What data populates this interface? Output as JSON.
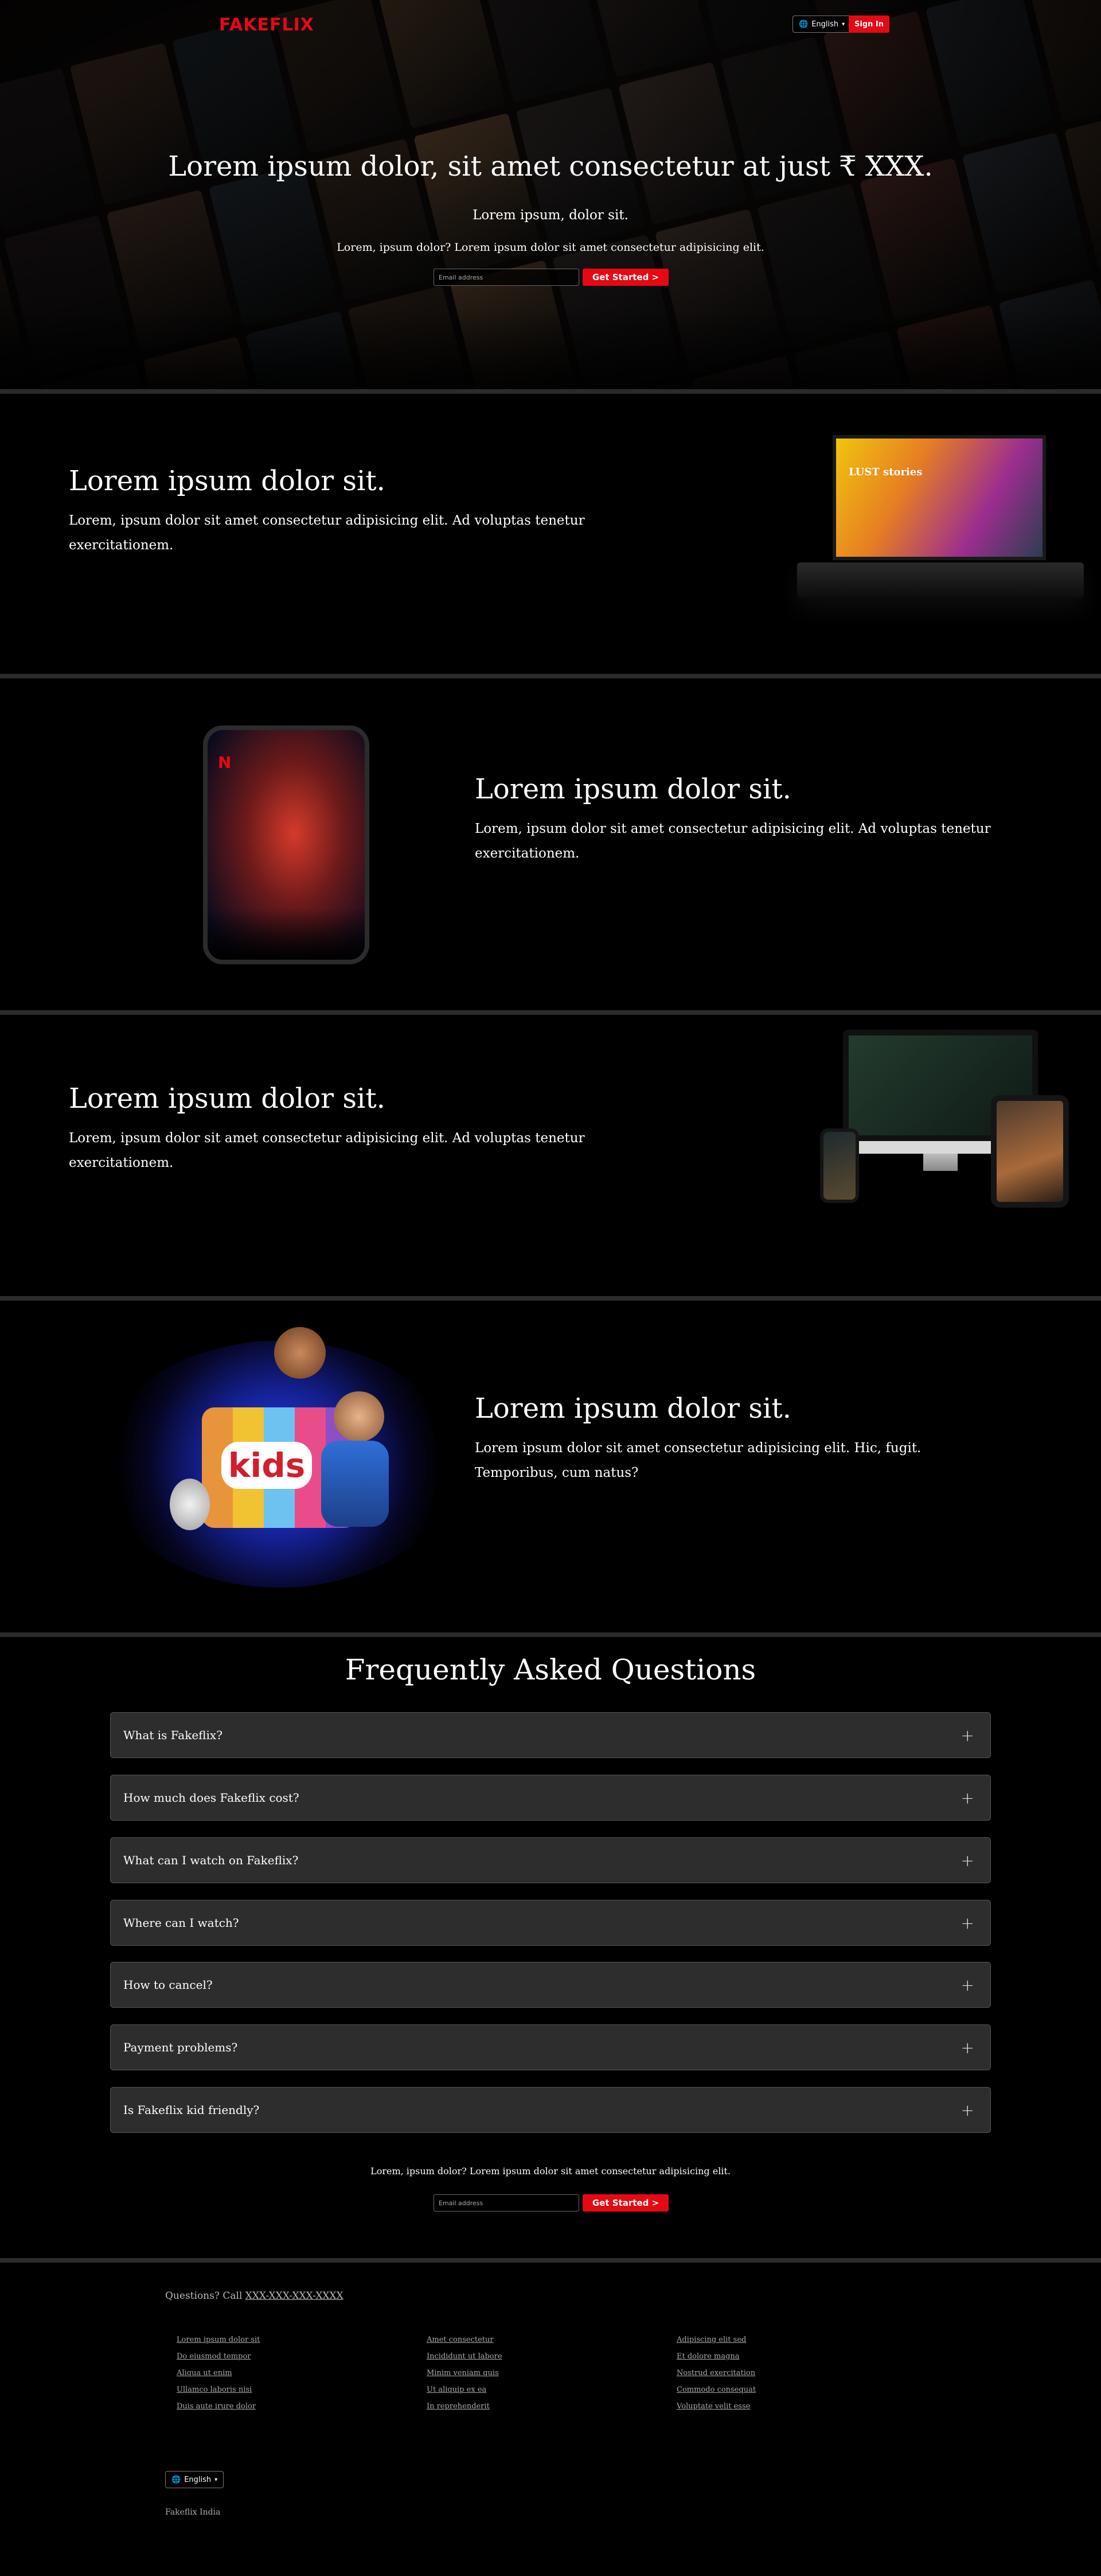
{
  "header": {
    "logo": "FAKEFLIX",
    "language": "English",
    "signin_label": "Sign In"
  },
  "hero": {
    "title": "Lorem ipsum dolor, sit amet consectetur at just ₹ XXX.",
    "subtitle": "Lorem ipsum, dolor sit.",
    "cta_text": "Lorem, ipsum dolor? Lorem ipsum dolor sit amet consectetur adipisicing elit.",
    "email_placeholder": "Email address",
    "get_started_label": "Get Started >"
  },
  "features": [
    {
      "title": "Lorem ipsum dolor sit.",
      "description": "Lorem, ipsum dolor sit amet consectetur adipisicing elit. Ad voluptas tenetur exercitationem.",
      "image_text": "LUST stories"
    },
    {
      "title": "Lorem ipsum dolor sit.",
      "description": "Lorem, ipsum dolor sit amet consectetur adipisicing elit. Ad voluptas tenetur exercitationem.",
      "image_text": "N"
    },
    {
      "title": "Lorem ipsum dolor sit.",
      "description": "Lorem, ipsum dolor sit amet consectetur adipisicing elit. Ad voluptas tenetur exercitationem."
    },
    {
      "title": "Lorem ipsum dolor sit.",
      "description": "Lorem ipsum dolor sit amet consectetur adipisicing elit. Hic, fugit. Temporibus, cum natus?",
      "image_text": "kids"
    }
  ],
  "faq": {
    "title": "Frequently Asked Questions",
    "items": [
      "What is Fakeflix?",
      "How much does Fakeflix cost?",
      "What can I watch on Fakeflix?",
      "Where can I watch?",
      "How to cancel?",
      "Payment problems?",
      "Is Fakeflix kid friendly?"
    ],
    "cta_text": "Lorem, ipsum dolor? Lorem ipsum dolor sit amet consectetur adipisicing elit.",
    "email_placeholder": "Email address",
    "get_started_label": "Get Started >"
  },
  "footer": {
    "questions_prefix": "Questions? Call ",
    "phone": "XXX-XXX-XXX-XXXX",
    "columns": [
      [
        "Lorem ipsum dolor sit",
        "Do eiusmod tempor",
        "Aliqua ut enim",
        "Ullamco laboris nisi",
        "Duis aute irure dolor"
      ],
      [
        "Amet consectetur",
        "Incididunt ut labore",
        "Minim veniam quis",
        "Ut aliquip ex ea",
        "In reprehenderit"
      ],
      [
        "Adipiscing elit sed",
        "Et dolore magna",
        "Nostrud exercitation",
        "Commodo consequat",
        "Voluptate velit esse"
      ]
    ],
    "language": "English",
    "country": "Fakeflix India"
  },
  "colors": {
    "brand_red": "#e50914",
    "background": "#000000",
    "divider": "#2b2b2b",
    "faq_item_bg": "#2d2d2d"
  },
  "icons": {
    "language": "globe-icon",
    "dropdown": "chevron-down-icon",
    "faq_expand": "plus-icon"
  }
}
